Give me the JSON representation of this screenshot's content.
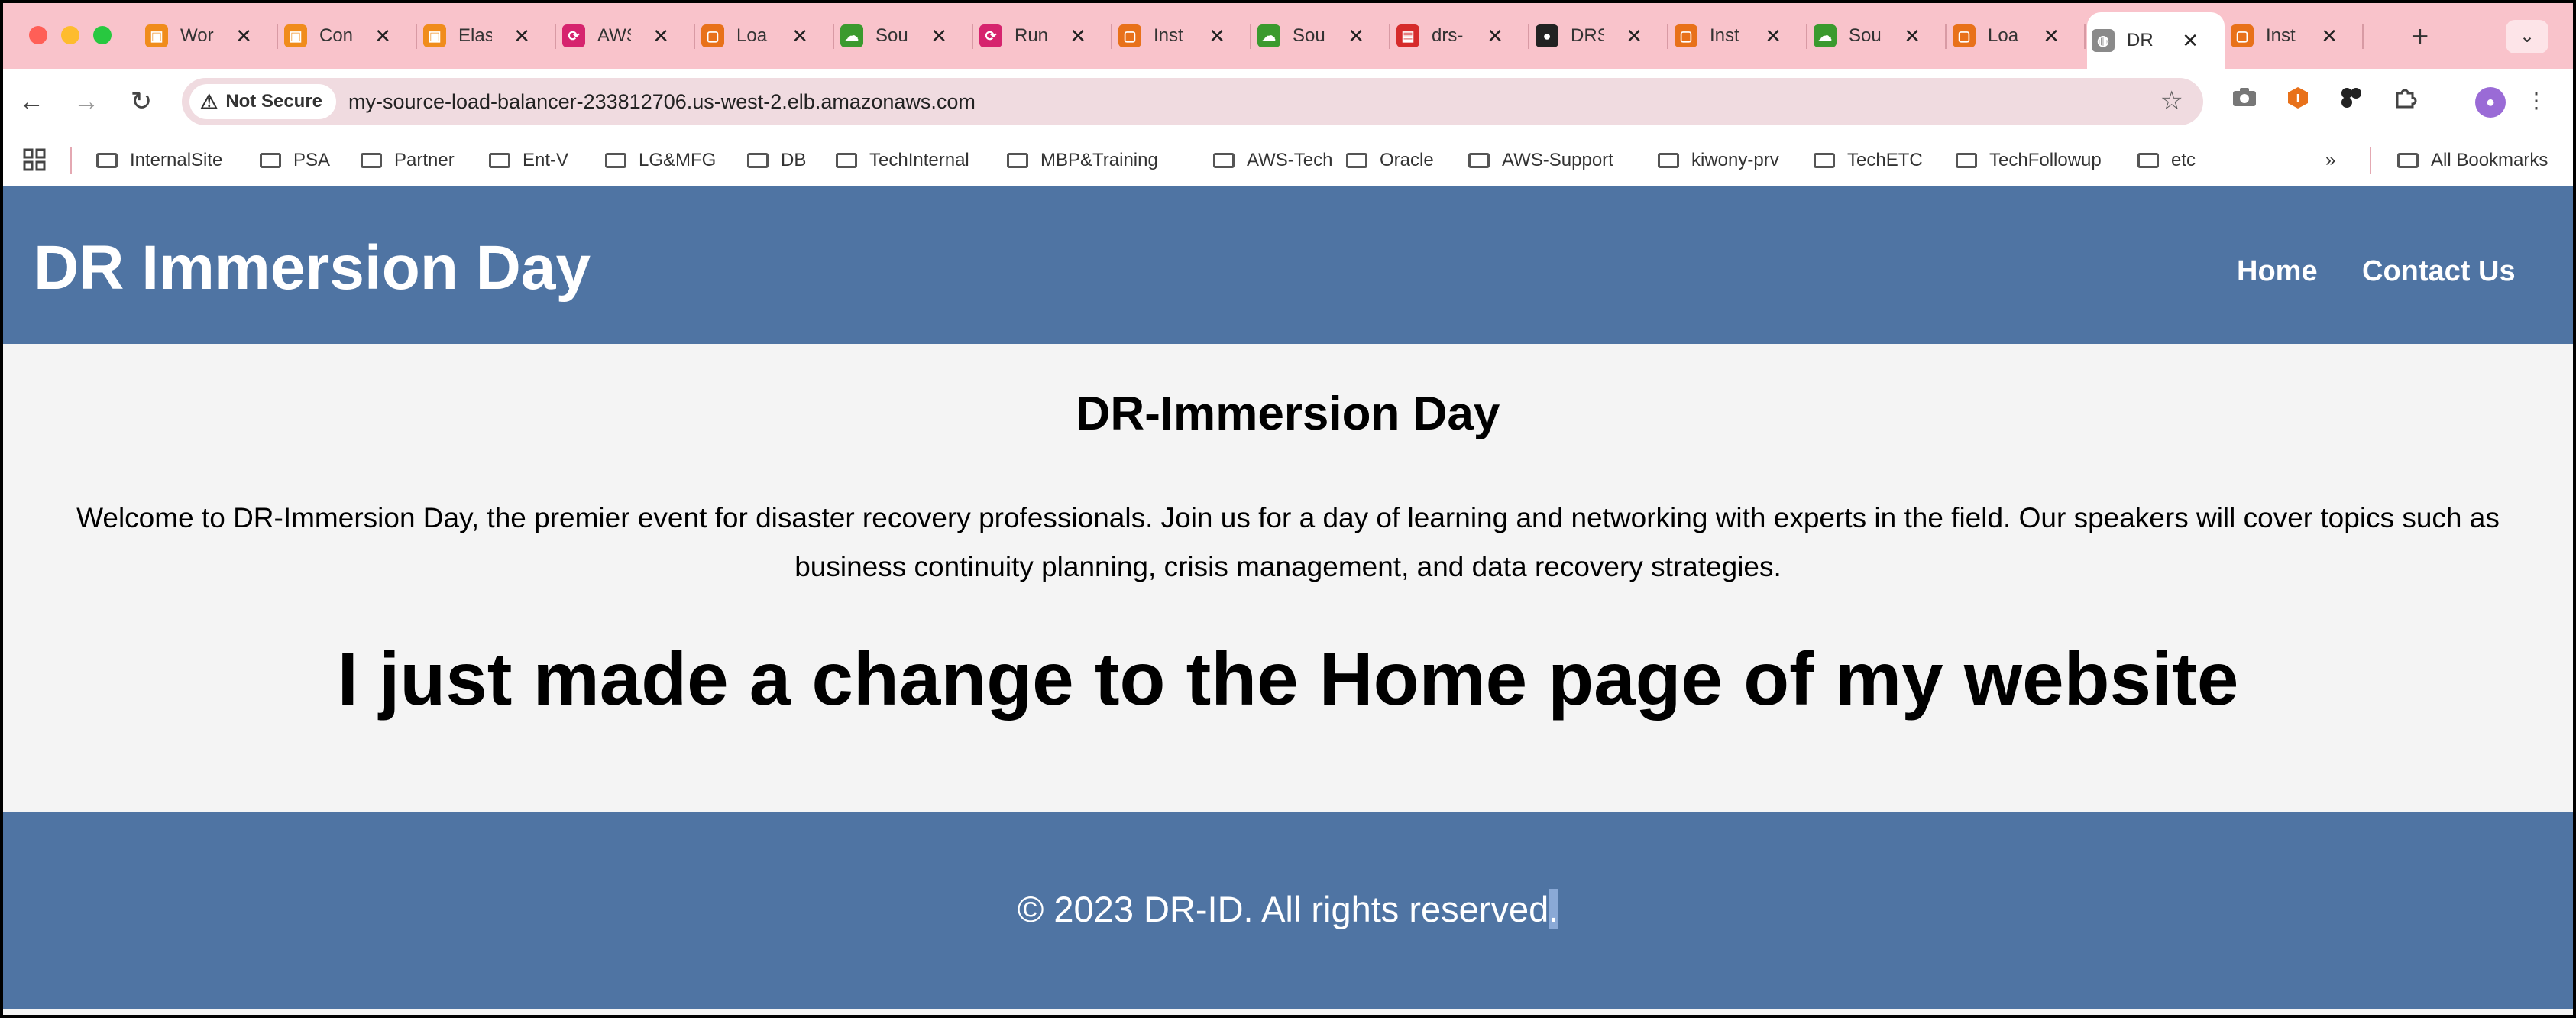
{
  "browser": {
    "tabs": [
      {
        "label": "Wor",
        "favicon": "aws-box-icon",
        "color": "#f08c1c"
      },
      {
        "label": "Con",
        "favicon": "aws-box-icon",
        "color": "#f08c1c"
      },
      {
        "label": "Elas",
        "favicon": "aws-box-icon",
        "color": "#f08c1c"
      },
      {
        "label": "AWS",
        "favicon": "aws-drs-icon",
        "color": "#d6246e"
      },
      {
        "label": "Loa",
        "favicon": "aws-ec2-icon",
        "color": "#e8711a"
      },
      {
        "label": "Sou",
        "favicon": "aws-s3-icon",
        "color": "#3b9a2e"
      },
      {
        "label": "Run",
        "favicon": "aws-drs-icon",
        "color": "#d6246e"
      },
      {
        "label": "Inst",
        "favicon": "aws-ec2-icon",
        "color": "#e8711a"
      },
      {
        "label": "Sou",
        "favicon": "aws-s3-icon",
        "color": "#3b9a2e"
      },
      {
        "label": "drs-",
        "favicon": "pdf-icon",
        "color": "#d62b2b"
      },
      {
        "label": "DRS",
        "favicon": "github-icon",
        "color": "#222222"
      },
      {
        "label": "Inst",
        "favicon": "aws-ec2-icon",
        "color": "#e8711a"
      },
      {
        "label": "Sou",
        "favicon": "aws-s3-icon",
        "color": "#3b9a2e"
      },
      {
        "label": "Loa",
        "favicon": "aws-ec2-icon",
        "color": "#e8711a"
      },
      {
        "label": "DR I",
        "favicon": "globe-icon",
        "color": "#8a8a8a",
        "active": true
      },
      {
        "label": "Inst",
        "favicon": "aws-ec2-icon",
        "color": "#e8711a"
      }
    ],
    "new_tab": "+",
    "security_label": "Not Secure",
    "url": "my-source-load-balancer-233812706.us-west-2.elb.amazonaws.com",
    "bookmarks": [
      "InternalSite",
      "PSA",
      "Partner",
      "Ent-V",
      "LG&MFG",
      "DB",
      "TechInternal",
      "MBP&Training",
      "AWS-Tech",
      "Oracle",
      "AWS-Support",
      "kiwony-prv",
      "TechETC",
      "TechFollowup",
      "etc"
    ],
    "bookmarks_overflow": "»",
    "all_bookmarks": "All Bookmarks"
  },
  "site": {
    "title": "DR Immersion Day",
    "nav": {
      "home": "Home",
      "contact": "Contact Us"
    },
    "heading": "DR-Immersion Day",
    "intro": "Welcome to DR-Immersion Day, the premier event for disaster recovery professionals. Join us for a day of learning and networking with experts in the field. Our speakers will cover topics such as business continuity planning, crisis management, and data recovery strategies.",
    "big_heading": "I just made a change to the Home page of my website",
    "footer_text": "© 2023 DR-ID. All rights reserved",
    "footer_period": ".",
    "colors": {
      "header_bg": "#4f74a3",
      "tabstrip_bg": "#f9c3cb"
    }
  }
}
